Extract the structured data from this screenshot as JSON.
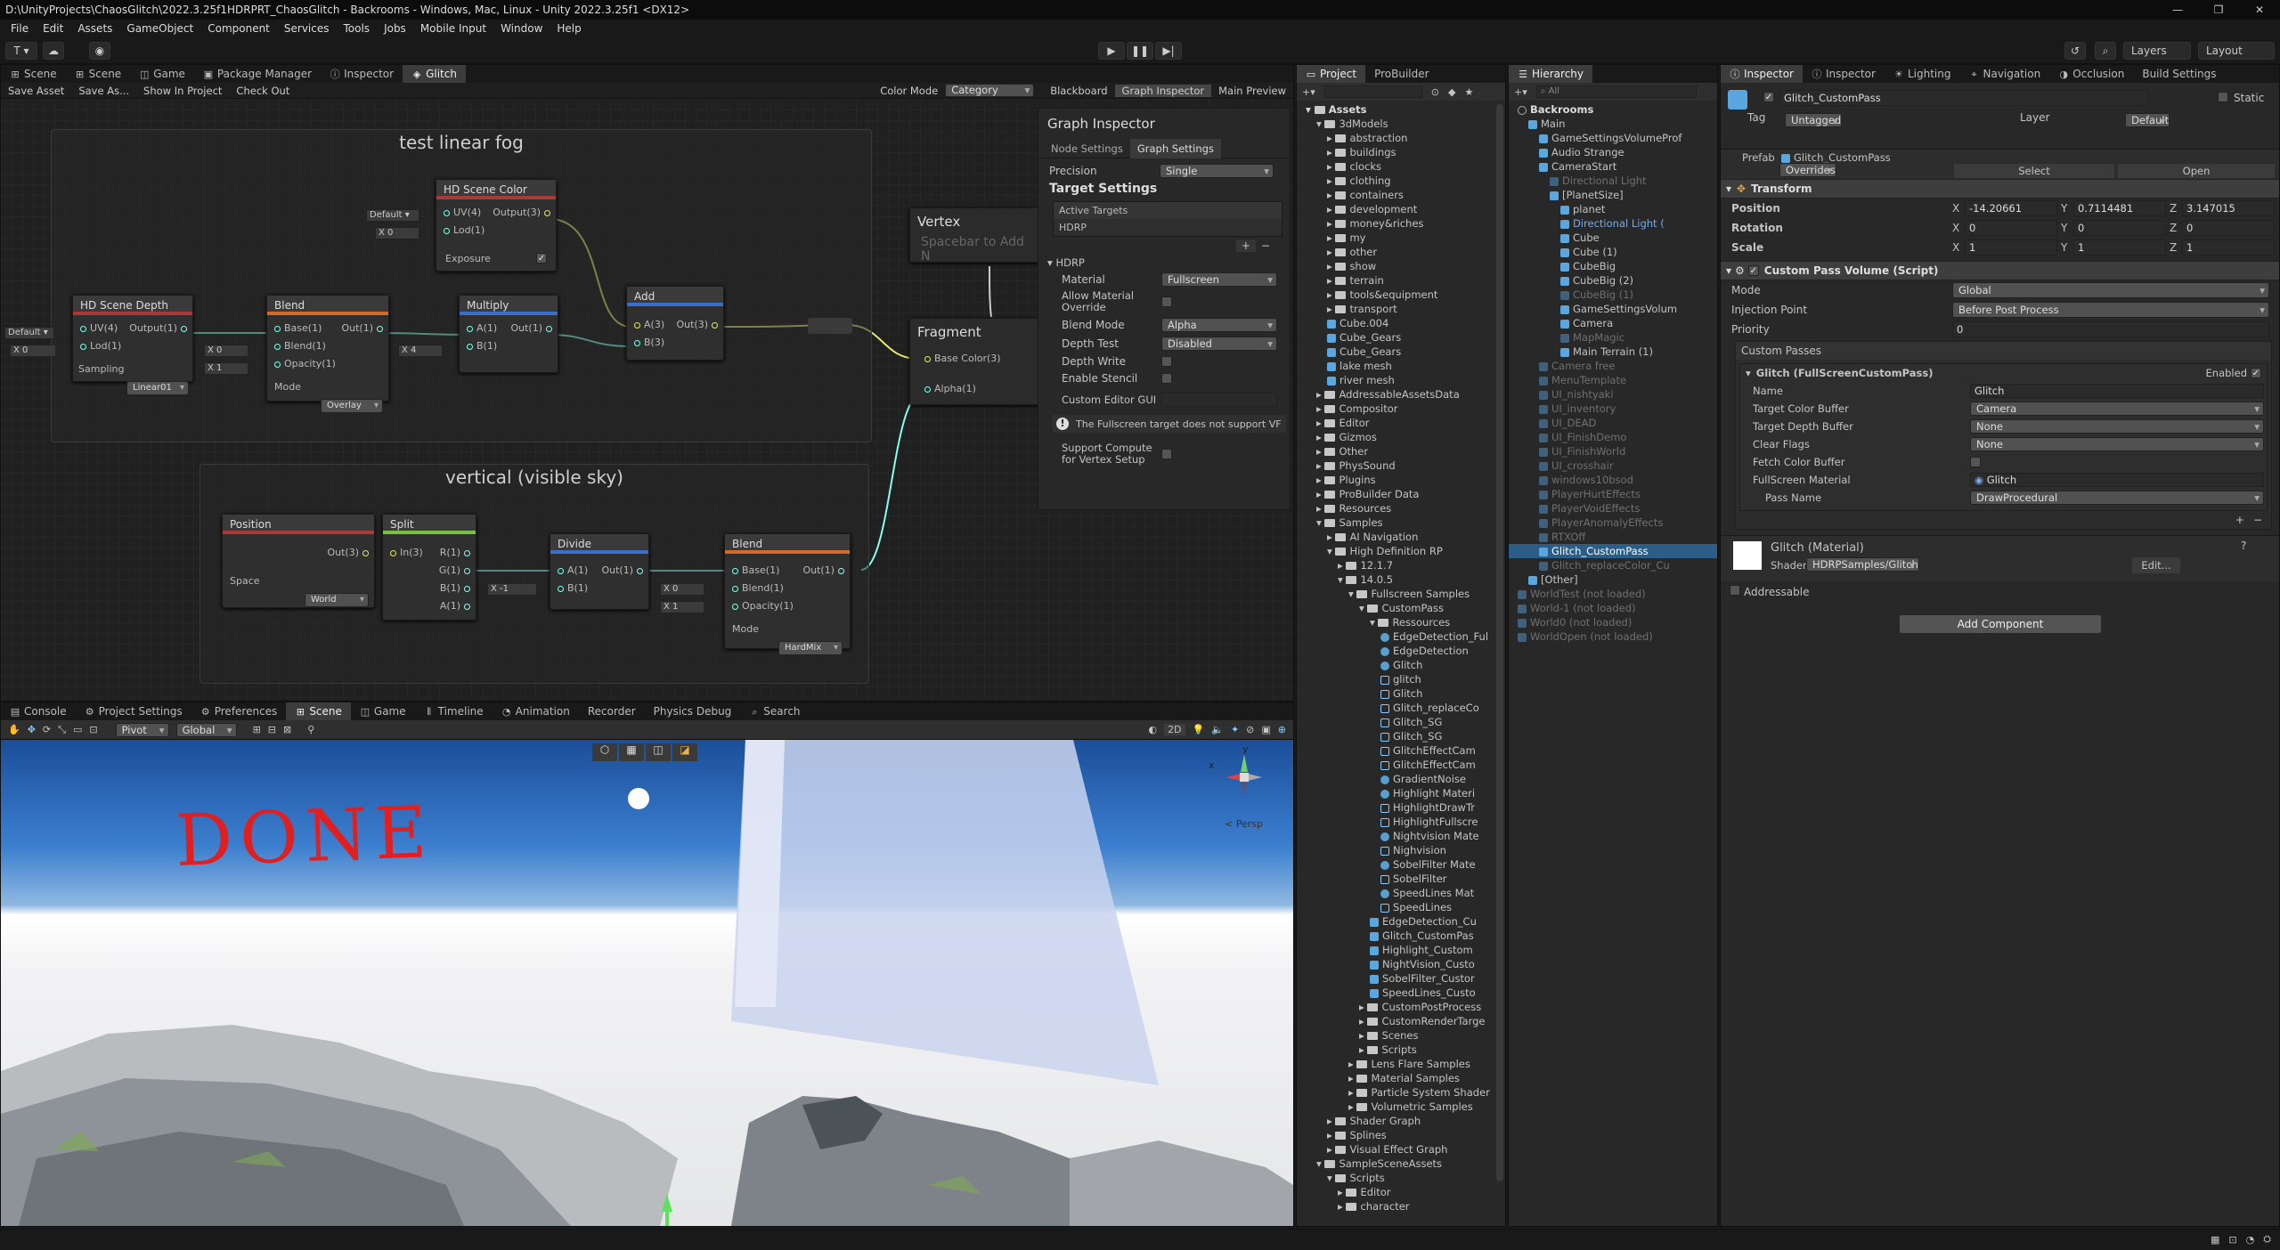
{
  "window": {
    "title": "D:\\UnityProjects\\ChaosGlitch\\2022.3.25f1HDRPRT_ChaosGlitch - Backrooms - Windows, Mac, Linux - Unity 2022.3.25f1 <DX12>"
  },
  "menu": [
    "File",
    "Edit",
    "Assets",
    "GameObject",
    "Component",
    "Services",
    "Tools",
    "Jobs",
    "Mobile Input",
    "Window",
    "Help"
  ],
  "toolbar": {
    "account": "T ▾",
    "layers": "Layers",
    "layout": "Layout"
  },
  "top_tabs": [
    "Scene",
    "Scene",
    "Game",
    "Package Manager",
    "Inspector",
    "Glitch"
  ],
  "sg_toolbar": {
    "save_asset": "Save Asset",
    "save_as": "Save As...",
    "show_in_project": "Show In Project",
    "check_out": "Check Out",
    "color_mode_label": "Color Mode",
    "color_mode_value": "Category",
    "blackboard": "Blackboard",
    "graph_inspector": "Graph Inspector",
    "main_preview": "Main Preview"
  },
  "graph": {
    "group1_title": "test linear fog",
    "group2_title": "vertical (visible sky)",
    "nodes": {
      "scene_color": {
        "title": "HD Scene Color",
        "uv": "UV(4)",
        "lod": "Lod(1)",
        "out": "Output(3)",
        "exposure": "Exposure",
        "default": "Default ▾",
        "x": "X",
        "xval": "0"
      },
      "scene_depth": {
        "title": "HD Scene Depth",
        "uv": "UV(4)",
        "lod": "Lod(1)",
        "out": "Output(1)",
        "sampling": "Sampling",
        "sampling_val": "Linear01",
        "default": "Default ▾",
        "x": "X",
        "xval": "0"
      },
      "blend1": {
        "title": "Blend",
        "base": "Base(1)",
        "blend": "Blend(1)",
        "opacity": "Opacity(1)",
        "out": "Out(1)",
        "mode": "Mode",
        "mode_val": "Overlay",
        "x": "X",
        "x0": "0",
        "x1": "1"
      },
      "multiply": {
        "title": "Multiply",
        "a": "A(1)",
        "b": "B(1)",
        "out": "Out(1)",
        "x": "X",
        "xval": "4"
      },
      "add": {
        "title": "Add",
        "a": "A(3)",
        "b": "B(3)",
        "out": "Out(3)"
      },
      "position": {
        "title": "Position",
        "out": "Out(3)",
        "space": "Space",
        "space_val": "World"
      },
      "split": {
        "title": "Split",
        "in": "In(3)",
        "r": "R(1)",
        "g": "G(1)",
        "b": "B(1)",
        "a": "A(1)"
      },
      "divide": {
        "title": "Divide",
        "a": "A(1)",
        "b": "B(1)",
        "out": "Out(1)",
        "x": "X",
        "xval": "-1"
      },
      "blend2": {
        "title": "Blend",
        "base": "Base(1)",
        "blend": "Blend(1)",
        "opacity": "Opacity(1)",
        "out": "Out(1)",
        "mode": "Mode",
        "mode_val": "HardMix",
        "x": "X",
        "x0": "0",
        "x1": "1"
      },
      "vertex": {
        "title": "Vertex",
        "hint": "Spacebar to Add N"
      },
      "fragment": {
        "title": "Fragment",
        "base_color": "Base Color(3)",
        "alpha": "Alpha(1)"
      }
    }
  },
  "graph_inspector": {
    "title": "Graph Inspector",
    "tab_node": "Node Settings",
    "tab_graph": "Graph Settings",
    "precision_label": "Precision",
    "precision_value": "Single",
    "target_settings": "Target Settings",
    "active_targets": "Active Targets",
    "hdrp": "HDRP",
    "hdrp_section": "HDRP",
    "material_label": "Material",
    "material_value": "Fullscreen",
    "allow_override": "Allow Material Override",
    "blend_mode_label": "Blend Mode",
    "blend_mode_value": "Alpha",
    "depth_test_label": "Depth Test",
    "depth_test_value": "Disabled",
    "depth_write": "Depth Write",
    "enable_stencil": "Enable Stencil",
    "custom_editor": "Custom Editor GUI",
    "warning": "The Fullscreen target does not support VF",
    "support_compute": "Support Compute for Vertex Setup"
  },
  "bottom_tabs": [
    "Console",
    "Project Settings",
    "Preferences",
    "Scene",
    "Game",
    "Timeline",
    "Animation",
    "Recorder",
    "Physics Debug",
    "Search"
  ],
  "scene_toolbar": {
    "pivot": "Pivot",
    "global": "Global",
    "mode_2d": "2D"
  },
  "scene_view": {
    "drawn_text": "DONE",
    "persp": "< Persp",
    "axis_x": "x",
    "axis_y": "y"
  },
  "project": {
    "tabs": [
      "Project",
      "ProBuilder"
    ],
    "root": "Assets",
    "rows": [
      {
        "t": "3dModels",
        "d": 1,
        "k": "folder",
        "open": true
      },
      {
        "t": "abstraction",
        "d": 2,
        "k": "folder"
      },
      {
        "t": "buildings",
        "d": 2,
        "k": "folder"
      },
      {
        "t": "clocks",
        "d": 2,
        "k": "folder"
      },
      {
        "t": "clothing",
        "d": 2,
        "k": "folder"
      },
      {
        "t": "containers",
        "d": 2,
        "k": "folder"
      },
      {
        "t": "development",
        "d": 2,
        "k": "folder"
      },
      {
        "t": "money&riches",
        "d": 2,
        "k": "folder"
      },
      {
        "t": "my",
        "d": 2,
        "k": "folder"
      },
      {
        "t": "other",
        "d": 2,
        "k": "folder"
      },
      {
        "t": "show",
        "d": 2,
        "k": "folder"
      },
      {
        "t": "terrain",
        "d": 2,
        "k": "folder"
      },
      {
        "t": "tools&equipment",
        "d": 2,
        "k": "folder"
      },
      {
        "t": "transport",
        "d": 2,
        "k": "folder"
      },
      {
        "t": "Cube.004",
        "d": 2,
        "k": "cube"
      },
      {
        "t": "Cube_Gears",
        "d": 2,
        "k": "cube"
      },
      {
        "t": "Cube_Gears",
        "d": 2,
        "k": "cube"
      },
      {
        "t": "lake mesh",
        "d": 2,
        "k": "cube"
      },
      {
        "t": "river mesh",
        "d": 2,
        "k": "cube"
      },
      {
        "t": "AddressableAssetsData",
        "d": 1,
        "k": "folder"
      },
      {
        "t": "Compositor",
        "d": 1,
        "k": "folder"
      },
      {
        "t": "Editor",
        "d": 1,
        "k": "folder"
      },
      {
        "t": "Gizmos",
        "d": 1,
        "k": "folder"
      },
      {
        "t": "Other",
        "d": 1,
        "k": "folder"
      },
      {
        "t": "PhysSound",
        "d": 1,
        "k": "folder"
      },
      {
        "t": "Plugins",
        "d": 1,
        "k": "folder"
      },
      {
        "t": "ProBuilder Data",
        "d": 1,
        "k": "folder"
      },
      {
        "t": "Resources",
        "d": 1,
        "k": "folder"
      },
      {
        "t": "Samples",
        "d": 1,
        "k": "folder",
        "open": true
      },
      {
        "t": "AI Navigation",
        "d": 2,
        "k": "folder"
      },
      {
        "t": "High Definition RP",
        "d": 2,
        "k": "folder",
        "open": true
      },
      {
        "t": "12.1.7",
        "d": 3,
        "k": "folder"
      },
      {
        "t": "14.0.5",
        "d": 3,
        "k": "folder",
        "open": true
      },
      {
        "t": "Fullscreen Samples",
        "d": 4,
        "k": "folder",
        "open": true
      },
      {
        "t": "CustomPass",
        "d": 5,
        "k": "folder",
        "open": true
      },
      {
        "t": "Ressources",
        "d": 6,
        "k": "folder",
        "open": true
      },
      {
        "t": "EdgeDetection_Ful",
        "d": 7,
        "k": "mat"
      },
      {
        "t": "EdgeDetection",
        "d": 7,
        "k": "mat"
      },
      {
        "t": "Glitch",
        "d": 7,
        "k": "mat"
      },
      {
        "t": "glitch",
        "d": 7,
        "k": "sg"
      },
      {
        "t": "Glitch",
        "d": 7,
        "k": "sg"
      },
      {
        "t": "Glitch_replaceCo",
        "d": 7,
        "k": "sg"
      },
      {
        "t": "Glitch_SG",
        "d": 7,
        "k": "sg"
      },
      {
        "t": "Glitch_SG",
        "d": 7,
        "k": "sg"
      },
      {
        "t": "GlitchEffectCam",
        "d": 7,
        "k": "sg"
      },
      {
        "t": "GlitchEffectCam",
        "d": 7,
        "k": "sg"
      },
      {
        "t": "GradientNoise",
        "d": 7,
        "k": "mat"
      },
      {
        "t": "Highlight Materi",
        "d": 7,
        "k": "mat"
      },
      {
        "t": "HighlightDrawTr",
        "d": 7,
        "k": "sg"
      },
      {
        "t": "HighlightFullscre",
        "d": 7,
        "k": "sg"
      },
      {
        "t": "Nightvision Mate",
        "d": 7,
        "k": "mat"
      },
      {
        "t": "Nighvision",
        "d": 7,
        "k": "sg"
      },
      {
        "t": "SobelFilter Mate",
        "d": 7,
        "k": "mat"
      },
      {
        "t": "SobelFilter",
        "d": 7,
        "k": "sg"
      },
      {
        "t": "SpeedLines Mat",
        "d": 7,
        "k": "mat"
      },
      {
        "t": "SpeedLines",
        "d": 7,
        "k": "sg"
      },
      {
        "t": "EdgeDetection_Cu",
        "d": 6,
        "k": "cube"
      },
      {
        "t": "Glitch_CustomPas",
        "d": 6,
        "k": "cube"
      },
      {
        "t": "Highlight_Custom",
        "d": 6,
        "k": "cube"
      },
      {
        "t": "NightVision_Custo",
        "d": 6,
        "k": "cube"
      },
      {
        "t": "SobelFilter_Custor",
        "d": 6,
        "k": "cube"
      },
      {
        "t": "SpeedLines_Custo",
        "d": 6,
        "k": "cube"
      },
      {
        "t": "CustomPostProcess",
        "d": 5,
        "k": "folder"
      },
      {
        "t": "CustomRenderTarge",
        "d": 5,
        "k": "folder"
      },
      {
        "t": "Scenes",
        "d": 5,
        "k": "folder"
      },
      {
        "t": "Scripts",
        "d": 5,
        "k": "folder"
      },
      {
        "t": "Lens Flare Samples",
        "d": 4,
        "k": "folder"
      },
      {
        "t": "Material Samples",
        "d": 4,
        "k": "folder"
      },
      {
        "t": "Particle System Shader",
        "d": 4,
        "k": "folder"
      },
      {
        "t": "Volumetric Samples",
        "d": 4,
        "k": "folder"
      },
      {
        "t": "Shader Graph",
        "d": 2,
        "k": "folder"
      },
      {
        "t": "Splines",
        "d": 2,
        "k": "folder"
      },
      {
        "t": "Visual Effect Graph",
        "d": 2,
        "k": "folder"
      },
      {
        "t": "SampleSceneAssets",
        "d": 1,
        "k": "folder",
        "open": true
      },
      {
        "t": "Scripts",
        "d": 2,
        "k": "folder",
        "open": true
      },
      {
        "t": "Editor",
        "d": 3,
        "k": "folder"
      },
      {
        "t": "character",
        "d": 3,
        "k": "folder"
      }
    ]
  },
  "hierarchy": {
    "tab": "Hierarchy",
    "search": "All",
    "rows": [
      {
        "t": "Backrooms",
        "d": 0,
        "c": "root"
      },
      {
        "t": "Main",
        "d": 1,
        "c": "n"
      },
      {
        "t": "GameSettingsVolumeProf",
        "d": 2,
        "c": "n"
      },
      {
        "t": "Audio Strange",
        "d": 2,
        "c": "n"
      },
      {
        "t": "CameraStart",
        "d": 2,
        "c": "n"
      },
      {
        "t": "Directional Light",
        "d": 3,
        "c": "g"
      },
      {
        "t": "[PlanetSize]",
        "d": 3,
        "c": "n"
      },
      {
        "t": "planet",
        "d": 4,
        "c": "n"
      },
      {
        "t": "Directional Light (",
        "d": 4,
        "c": "b"
      },
      {
        "t": "Cube",
        "d": 4,
        "c": "n"
      },
      {
        "t": "Cube (1)",
        "d": 4,
        "c": "n"
      },
      {
        "t": "CubeBig",
        "d": 4,
        "c": "n"
      },
      {
        "t": "CubeBig (2)",
        "d": 4,
        "c": "n"
      },
      {
        "t": "CubeBig (1)",
        "d": 4,
        "c": "g"
      },
      {
        "t": "GameSettingsVolum",
        "d": 4,
        "c": "n"
      },
      {
        "t": "Camera",
        "d": 4,
        "c": "n"
      },
      {
        "t": "MapMagic",
        "d": 4,
        "c": "g"
      },
      {
        "t": "Main Terrain (1)",
        "d": 4,
        "c": "n"
      },
      {
        "t": "Camera free",
        "d": 2,
        "c": "g"
      },
      {
        "t": "MenuTemplate",
        "d": 2,
        "c": "g"
      },
      {
        "t": "UI_nishtyaki",
        "d": 2,
        "c": "g"
      },
      {
        "t": "UI_inventory",
        "d": 2,
        "c": "g"
      },
      {
        "t": "UI_DEAD",
        "d": 2,
        "c": "g"
      },
      {
        "t": "UI_FinishDemo",
        "d": 2,
        "c": "g"
      },
      {
        "t": "UI_FinishWorld",
        "d": 2,
        "c": "g"
      },
      {
        "t": "UI_crosshair",
        "d": 2,
        "c": "g"
      },
      {
        "t": "windows10bsod",
        "d": 2,
        "c": "g"
      },
      {
        "t": "PlayerHurtEffects",
        "d": 2,
        "c": "g"
      },
      {
        "t": "PlayerVoidEffects",
        "d": 2,
        "c": "g"
      },
      {
        "t": "PlayerAnomalyEffects",
        "d": 2,
        "c": "g"
      },
      {
        "t": "RTXOff",
        "d": 2,
        "c": "g"
      },
      {
        "t": "Glitch_CustomPass",
        "d": 2,
        "c": "sel"
      },
      {
        "t": "Glitch_replaceColor_Cu",
        "d": 2,
        "c": "g"
      },
      {
        "t": "[Other]",
        "d": 1,
        "c": "n"
      },
      {
        "t": "WorldTest (not loaded)",
        "d": 0,
        "c": "g"
      },
      {
        "t": "World-1 (not loaded)",
        "d": 0,
        "c": "g"
      },
      {
        "t": "World0 (not loaded)",
        "d": 0,
        "c": "g"
      },
      {
        "t": "WorldOpen (not loaded)",
        "d": 0,
        "c": "g"
      }
    ]
  },
  "inspector": {
    "tabs": [
      "Inspector",
      "Inspector",
      "Lighting",
      "Navigation",
      "Occlusion",
      "Build Settings"
    ],
    "object_name": "Glitch_CustomPass",
    "static": "Static",
    "tag_label": "Tag",
    "tag_value": "Untagged",
    "layer_label": "Layer",
    "layer_value": "Default",
    "prefab_label": "Prefab",
    "prefab_value": "Glitch_CustomPass",
    "overrides": "Overrides",
    "select": "Select",
    "open": "Open",
    "transform": "Transform",
    "position": "Position",
    "rotation": "Rotation",
    "scale": "Scale",
    "pos": [
      "-14.20661",
      "0.7114481",
      "3.147015"
    ],
    "rot": [
      "0",
      "0",
      "0"
    ],
    "scl": [
      "1",
      "1",
      "1"
    ],
    "x": "X",
    "y": "Y",
    "z": "Z",
    "cpv_title": "Custom Pass Volume (Script)",
    "mode_label": "Mode",
    "mode_value": "Global",
    "injection_label": "Injection Point",
    "injection_value": "Before Post Process",
    "priority_label": "Priority",
    "priority_value": "0",
    "custom_passes": "Custom Passes",
    "pass_title": "Glitch (FullScreenCustomPass)",
    "enabled": "Enabled",
    "name_label": "Name",
    "name_value": "Glitch",
    "tcb_label": "Target Color Buffer",
    "tcb_value": "Camera",
    "tdb_label": "Target Depth Buffer",
    "tdb_value": "None",
    "clear_label": "Clear Flags",
    "clear_value": "None",
    "fetch_label": "Fetch Color Buffer",
    "fsm_label": "FullScreen Material",
    "fsm_value": "Glitch",
    "pass_label": "Pass Name",
    "pass_value": "DrawProcedural",
    "material_title": "Glitch (Material)",
    "shader_label": "Shader",
    "shader_value": "HDRPSamples/Glitch",
    "edit": "Edit...",
    "addressable": "Addressable",
    "add_component": "Add Component"
  },
  "colors": {
    "accent": "#2c5d87",
    "selection": "#2c5d87",
    "panel": "#282828",
    "node_red": "#b03030",
    "node_orange": "#d46a2a",
    "node_blue": "#3a6ec8",
    "node_green": "#77c043"
  }
}
